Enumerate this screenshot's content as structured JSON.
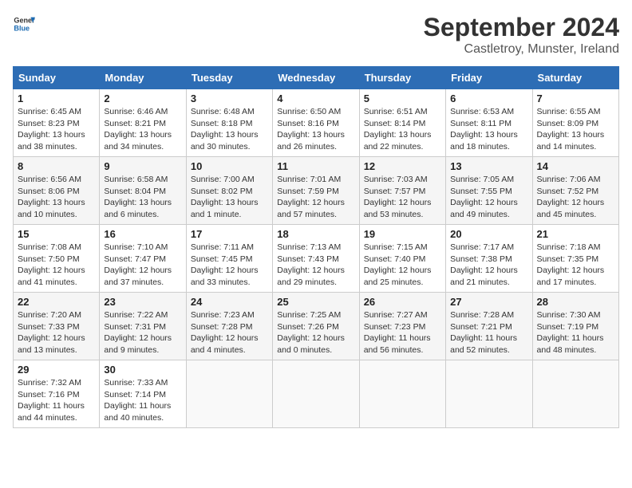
{
  "header": {
    "logo_line1": "General",
    "logo_line2": "Blue",
    "month": "September 2024",
    "location": "Castletroy, Munster, Ireland"
  },
  "days_of_week": [
    "Sunday",
    "Monday",
    "Tuesday",
    "Wednesday",
    "Thursday",
    "Friday",
    "Saturday"
  ],
  "weeks": [
    [
      {
        "day": "1",
        "info": "Sunrise: 6:45 AM\nSunset: 8:23 PM\nDaylight: 13 hours\nand 38 minutes."
      },
      {
        "day": "2",
        "info": "Sunrise: 6:46 AM\nSunset: 8:21 PM\nDaylight: 13 hours\nand 34 minutes."
      },
      {
        "day": "3",
        "info": "Sunrise: 6:48 AM\nSunset: 8:18 PM\nDaylight: 13 hours\nand 30 minutes."
      },
      {
        "day": "4",
        "info": "Sunrise: 6:50 AM\nSunset: 8:16 PM\nDaylight: 13 hours\nand 26 minutes."
      },
      {
        "day": "5",
        "info": "Sunrise: 6:51 AM\nSunset: 8:14 PM\nDaylight: 13 hours\nand 22 minutes."
      },
      {
        "day": "6",
        "info": "Sunrise: 6:53 AM\nSunset: 8:11 PM\nDaylight: 13 hours\nand 18 minutes."
      },
      {
        "day": "7",
        "info": "Sunrise: 6:55 AM\nSunset: 8:09 PM\nDaylight: 13 hours\nand 14 minutes."
      }
    ],
    [
      {
        "day": "8",
        "info": "Sunrise: 6:56 AM\nSunset: 8:06 PM\nDaylight: 13 hours\nand 10 minutes."
      },
      {
        "day": "9",
        "info": "Sunrise: 6:58 AM\nSunset: 8:04 PM\nDaylight: 13 hours\nand 6 minutes."
      },
      {
        "day": "10",
        "info": "Sunrise: 7:00 AM\nSunset: 8:02 PM\nDaylight: 13 hours\nand 1 minute."
      },
      {
        "day": "11",
        "info": "Sunrise: 7:01 AM\nSunset: 7:59 PM\nDaylight: 12 hours\nand 57 minutes."
      },
      {
        "day": "12",
        "info": "Sunrise: 7:03 AM\nSunset: 7:57 PM\nDaylight: 12 hours\nand 53 minutes."
      },
      {
        "day": "13",
        "info": "Sunrise: 7:05 AM\nSunset: 7:55 PM\nDaylight: 12 hours\nand 49 minutes."
      },
      {
        "day": "14",
        "info": "Sunrise: 7:06 AM\nSunset: 7:52 PM\nDaylight: 12 hours\nand 45 minutes."
      }
    ],
    [
      {
        "day": "15",
        "info": "Sunrise: 7:08 AM\nSunset: 7:50 PM\nDaylight: 12 hours\nand 41 minutes."
      },
      {
        "day": "16",
        "info": "Sunrise: 7:10 AM\nSunset: 7:47 PM\nDaylight: 12 hours\nand 37 minutes."
      },
      {
        "day": "17",
        "info": "Sunrise: 7:11 AM\nSunset: 7:45 PM\nDaylight: 12 hours\nand 33 minutes."
      },
      {
        "day": "18",
        "info": "Sunrise: 7:13 AM\nSunset: 7:43 PM\nDaylight: 12 hours\nand 29 minutes."
      },
      {
        "day": "19",
        "info": "Sunrise: 7:15 AM\nSunset: 7:40 PM\nDaylight: 12 hours\nand 25 minutes."
      },
      {
        "day": "20",
        "info": "Sunrise: 7:17 AM\nSunset: 7:38 PM\nDaylight: 12 hours\nand 21 minutes."
      },
      {
        "day": "21",
        "info": "Sunrise: 7:18 AM\nSunset: 7:35 PM\nDaylight: 12 hours\nand 17 minutes."
      }
    ],
    [
      {
        "day": "22",
        "info": "Sunrise: 7:20 AM\nSunset: 7:33 PM\nDaylight: 12 hours\nand 13 minutes."
      },
      {
        "day": "23",
        "info": "Sunrise: 7:22 AM\nSunset: 7:31 PM\nDaylight: 12 hours\nand 9 minutes."
      },
      {
        "day": "24",
        "info": "Sunrise: 7:23 AM\nSunset: 7:28 PM\nDaylight: 12 hours\nand 4 minutes."
      },
      {
        "day": "25",
        "info": "Sunrise: 7:25 AM\nSunset: 7:26 PM\nDaylight: 12 hours\nand 0 minutes."
      },
      {
        "day": "26",
        "info": "Sunrise: 7:27 AM\nSunset: 7:23 PM\nDaylight: 11 hours\nand 56 minutes."
      },
      {
        "day": "27",
        "info": "Sunrise: 7:28 AM\nSunset: 7:21 PM\nDaylight: 11 hours\nand 52 minutes."
      },
      {
        "day": "28",
        "info": "Sunrise: 7:30 AM\nSunset: 7:19 PM\nDaylight: 11 hours\nand 48 minutes."
      }
    ],
    [
      {
        "day": "29",
        "info": "Sunrise: 7:32 AM\nSunset: 7:16 PM\nDaylight: 11 hours\nand 44 minutes."
      },
      {
        "day": "30",
        "info": "Sunrise: 7:33 AM\nSunset: 7:14 PM\nDaylight: 11 hours\nand 40 minutes."
      },
      {
        "day": "",
        "info": ""
      },
      {
        "day": "",
        "info": ""
      },
      {
        "day": "",
        "info": ""
      },
      {
        "day": "",
        "info": ""
      },
      {
        "day": "",
        "info": ""
      }
    ]
  ]
}
